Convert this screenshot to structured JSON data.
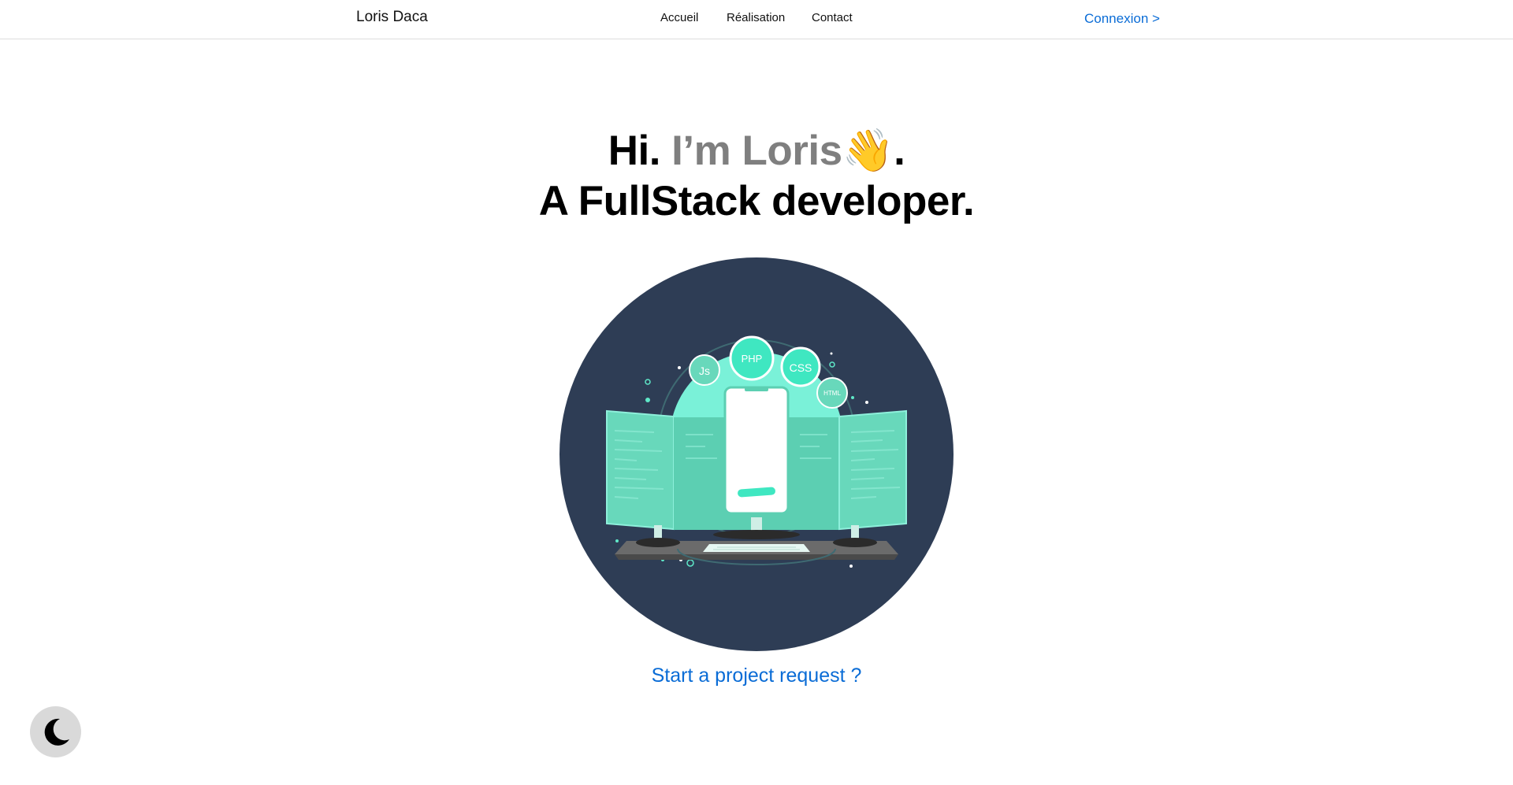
{
  "header": {
    "brand": "Loris Daca",
    "nav": [
      {
        "label": "Accueil"
      },
      {
        "label": "Réalisation"
      },
      {
        "label": "Contact"
      }
    ],
    "login_label": "Connexion >"
  },
  "hero": {
    "greeting": "Hi.",
    "name_phrase": "I’m Loris",
    "wave_icon": "👋",
    "period": ".",
    "line2": "A FullStack developer."
  },
  "illustration": {
    "badges": [
      "Js",
      "PHP",
      "CSS",
      "HTML"
    ],
    "icon": "developer-workstation-illustration",
    "colors": {
      "background": "#2e3d55",
      "accent": "#5fe8c8",
      "screen": "#68d8bb"
    }
  },
  "cta": {
    "label": "Start a project request ?"
  },
  "theme_toggle": {
    "icon": "moon-icon"
  },
  "colors": {
    "link": "#0a6cd6",
    "muted": "#7f7f7f",
    "text": "#000000"
  }
}
